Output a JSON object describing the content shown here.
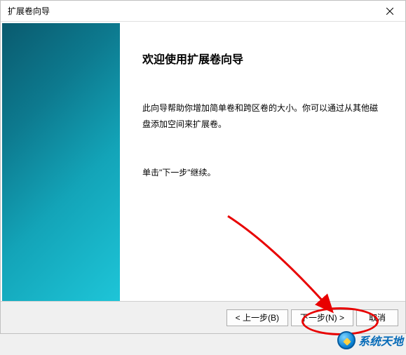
{
  "titlebar": {
    "title": "扩展卷向导"
  },
  "content": {
    "heading": "欢迎使用扩展卷向导",
    "description": "此向导帮助你增加简单卷和跨区卷的大小。你可以通过从其他磁盘添加空间来扩展卷。",
    "instruction": "单击\"下一步\"继续。"
  },
  "buttons": {
    "back": "< 上一步(B)",
    "next": "下一步(N) >",
    "cancel": "取消"
  },
  "watermark": {
    "text": "系统天地"
  }
}
